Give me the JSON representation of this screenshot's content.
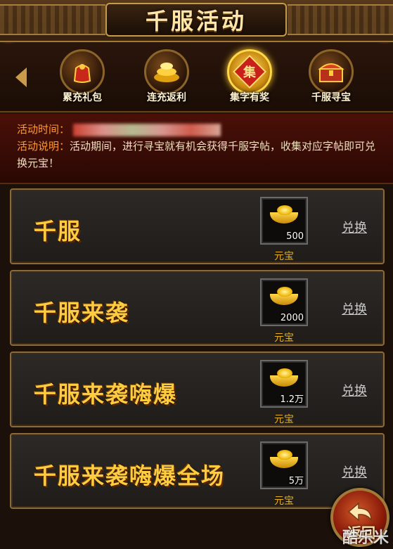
{
  "header": {
    "title": "千服活动"
  },
  "tabs": [
    {
      "label": "累充礼包",
      "icon": "gift-bag-icon"
    },
    {
      "label": "连充返利",
      "icon": "gold-coins-icon"
    },
    {
      "label": "集字有奖",
      "icon": "seal-icon",
      "seal_char": "集",
      "active": true
    },
    {
      "label": "千服寻宝",
      "icon": "treasure-chest-icon"
    }
  ],
  "info": {
    "time_label": "活动时间：",
    "desc_label": "活动说明：",
    "desc_text": "活动期间，进行寻宝就有机会获得千服字帖，收集对应字帖即可兑换元宝！"
  },
  "rewards": [
    {
      "title": "千服",
      "item_name": "元宝",
      "quantity": "500",
      "action": "兑换"
    },
    {
      "title": "千服来袭",
      "item_name": "元宝",
      "quantity": "2000",
      "action": "兑换"
    },
    {
      "title": "千服来袭嗨爆",
      "item_name": "元宝",
      "quantity": "1.2万",
      "action": "兑换"
    },
    {
      "title": "千服来袭嗨爆全场",
      "item_name": "元宝",
      "quantity": "5万",
      "action": "兑换"
    }
  ],
  "footer": {
    "return_label": "返回",
    "watermark": "酷乐米"
  },
  "colors": {
    "accent_gold": "#ffcc40",
    "info_key": "#ff9a30",
    "panel_red": "#4a1008"
  }
}
